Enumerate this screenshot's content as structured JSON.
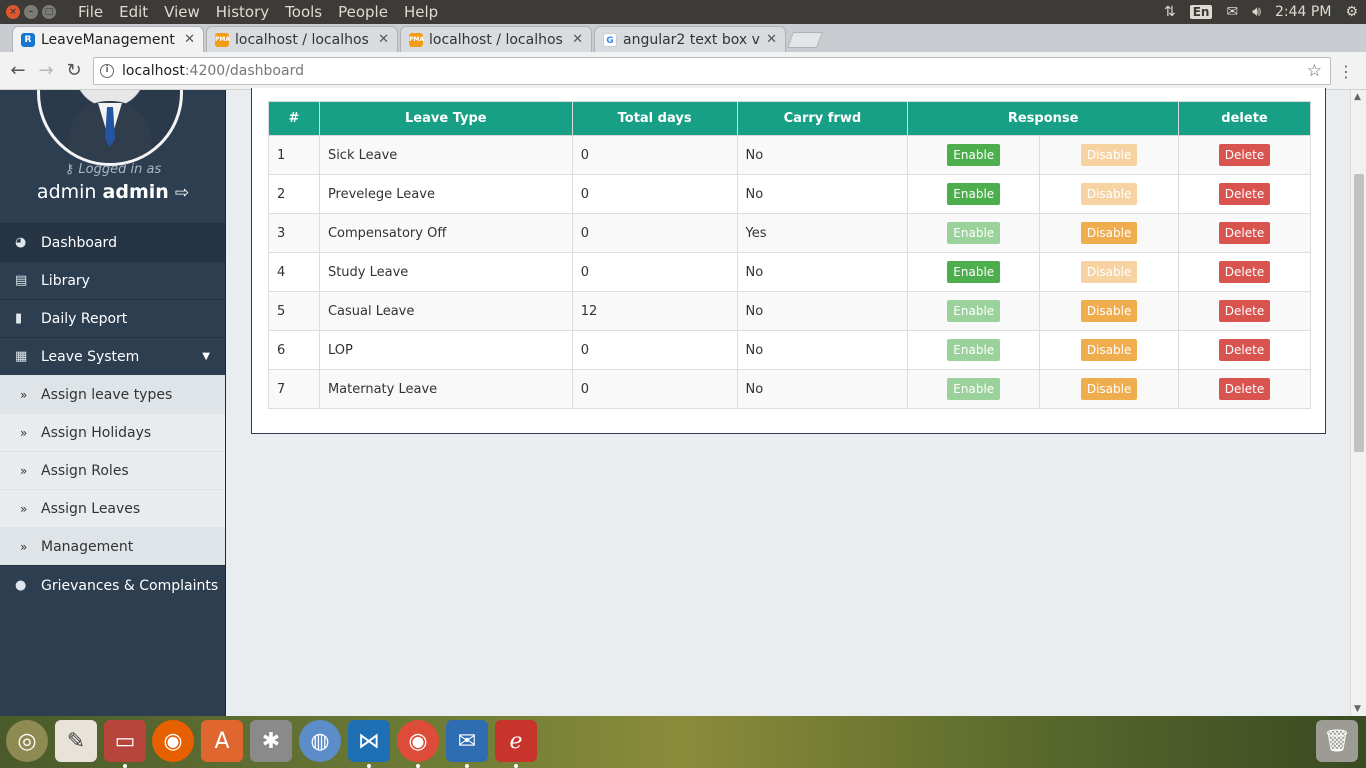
{
  "system_bar": {
    "menus": [
      "File",
      "Edit",
      "View",
      "History",
      "Tools",
      "People",
      "Help"
    ],
    "keyboard": "En",
    "time": "2:44 PM"
  },
  "tabs": [
    {
      "title": "LeaveManagement",
      "favicon": "angular-icon",
      "active": true
    },
    {
      "title": "localhost / localhos",
      "favicon": "pma-icon",
      "active": false
    },
    {
      "title": "localhost / localhos",
      "favicon": "pma-icon",
      "active": false
    },
    {
      "title": "angular2 text box v",
      "favicon": "google-icon",
      "active": false
    }
  ],
  "address": {
    "host": "localhost",
    "path": ":4200/dashboard"
  },
  "sidebar": {
    "logged_in_as": "Logged in as",
    "user_first": "admin",
    "user_last": "admin",
    "items": [
      {
        "label": "Dashboard",
        "icon": "dashboard-icon"
      },
      {
        "label": "Library",
        "icon": "book-icon"
      },
      {
        "label": "Daily Report",
        "icon": "file-icon"
      },
      {
        "label": "Leave System",
        "icon": "calendar-icon"
      }
    ],
    "subitems": [
      {
        "label": "Assign leave types"
      },
      {
        "label": "Assign Holidays"
      },
      {
        "label": "Assign Roles"
      },
      {
        "label": "Assign Leaves"
      },
      {
        "label": "Management"
      }
    ],
    "grievances": {
      "label": "Grievances & Complaints",
      "icon": "comments-icon"
    }
  },
  "table": {
    "headers": [
      "#",
      "Leave Type",
      "Total days",
      "Carry frwd",
      "Response",
      "delete"
    ],
    "enable_label": "Enable",
    "disable_label": "Disable",
    "delete_label": "Delete",
    "rows": [
      {
        "id": "1",
        "type": "Sick Leave",
        "days": "0",
        "carry": "No",
        "enabled": true
      },
      {
        "id": "2",
        "type": "Prevelege Leave",
        "days": "0",
        "carry": "No",
        "enabled": true
      },
      {
        "id": "3",
        "type": "Compensatory Off",
        "days": "0",
        "carry": "Yes",
        "enabled": false
      },
      {
        "id": "4",
        "type": "Study Leave",
        "days": "0",
        "carry": "No",
        "enabled": true
      },
      {
        "id": "5",
        "type": "Casual Leave",
        "days": "12",
        "carry": "No",
        "enabled": false
      },
      {
        "id": "6",
        "type": "LOP",
        "days": "0",
        "carry": "No",
        "enabled": false
      },
      {
        "id": "7",
        "type": "Maternaty Leave",
        "days": "0",
        "carry": "No",
        "enabled": false
      }
    ]
  },
  "colors": {
    "header": "#17a085",
    "sidebar": "#2c3e50",
    "enable": "#4cae4c",
    "disable": "#f0ad4e",
    "delete": "#d9534f"
  }
}
